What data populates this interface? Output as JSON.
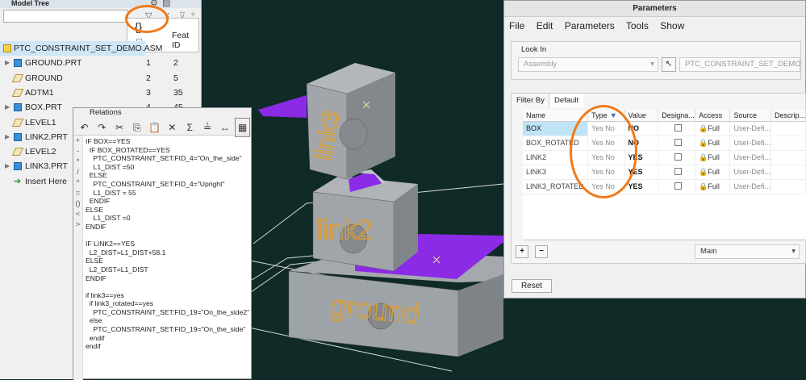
{
  "model_tree": {
    "title": "Model Tree",
    "popup_label": "Feat ID",
    "rows": [
      {
        "label": "PTC_CONSTRAINT_SET_DEMO.ASM",
        "c1": "",
        "c2": "",
        "icon": "assembly-icon"
      },
      {
        "label": "GROUND.PRT",
        "c1": "1",
        "c2": "2",
        "icon": "part-icon"
      },
      {
        "label": "GROUND",
        "c1": "2",
        "c2": "5",
        "icon": "datum-plane-icon"
      },
      {
        "label": "ADTM1",
        "c1": "3",
        "c2": "35",
        "icon": "datum-plane-icon"
      },
      {
        "label": "BOX.PRT",
        "c1": "4",
        "c2": "45",
        "icon": "part-icon"
      },
      {
        "label": "LEVEL1",
        "c1": "",
        "c2": "",
        "icon": "datum-plane-icon"
      },
      {
        "label": "LINK2.PRT",
        "c1": "",
        "c2": "",
        "icon": "part-icon"
      },
      {
        "label": "LEVEL2",
        "c1": "",
        "c2": "",
        "icon": "datum-plane-icon"
      },
      {
        "label": "LINK3.PRT",
        "c1": "",
        "c2": "",
        "icon": "part-icon"
      },
      {
        "label": "Insert Here",
        "c1": "",
        "c2": "",
        "icon": "insert-here-icon"
      }
    ]
  },
  "relations": {
    "title": "Relations",
    "code": "IF BOX==YES\n  IF BOX_ROTATED==YES\n    PTC_CONSTRAINT_SET:FID_4=\"On_the_side\"\n    L1_DIST =50\n  ELSE\n    PTC_CONSTRAINT_SET:FID_4=\"Upright\"\n    L1_DIST = 55\n  ENDIF\nELSE\n    L1_DIST =0\nENDIF\n\nIF LINK2==YES\n  L2_DIST=L1_DIST+58.1\nELSE\n  L2_DIST=L1_DIST\nENDIF\n\nif link3==yes\n  if link3_rotated==yes\n    PTC_CONSTRAINT_SET:FID_19=\"On_the_side2\"\n  else\n    PTC_CONSTRAINT_SET:FID_19=\"On_the_side\"\n  endif\nendif"
  },
  "scene": {
    "labels": [
      "link3",
      "link2",
      "ground"
    ],
    "accent": "#8a2be2",
    "label_color": "#e0a030"
  },
  "parameters": {
    "title": "Parameters",
    "menu": [
      "File",
      "Edit",
      "Parameters",
      "Tools",
      "Show"
    ],
    "look_in_label": "Look In",
    "look_in_value": "Assembly",
    "look_in_name": "PTC_CONSTRAINT_SET_DEMO",
    "filter_by_label": "Filter By",
    "filter_value": "Default",
    "columns": [
      "Name",
      "Type",
      "Value",
      "Designa...",
      "Access",
      "Source",
      "Descrip..."
    ],
    "rows": [
      {
        "name": "BOX",
        "type": "Yes No",
        "value": "NO",
        "access": "Full",
        "source": "User-Defi..."
      },
      {
        "name": "BOX_ROTATED",
        "type": "Yes No",
        "value": "NO",
        "access": "Full",
        "source": "User-Defi..."
      },
      {
        "name": "LINK2",
        "type": "Yes No",
        "value": "YES",
        "access": "Full",
        "source": "User-Defi..."
      },
      {
        "name": "LINK3",
        "type": "Yes No",
        "value": "YES",
        "access": "Full",
        "source": "User-Defi..."
      },
      {
        "name": "LINK3_ROTATED",
        "type": "Yes No",
        "value": "YES",
        "access": "Full",
        "source": "User-Defi..."
      }
    ],
    "main_select": "Main",
    "reset_label": "Reset",
    "add_label": "+",
    "remove_label": "−"
  }
}
